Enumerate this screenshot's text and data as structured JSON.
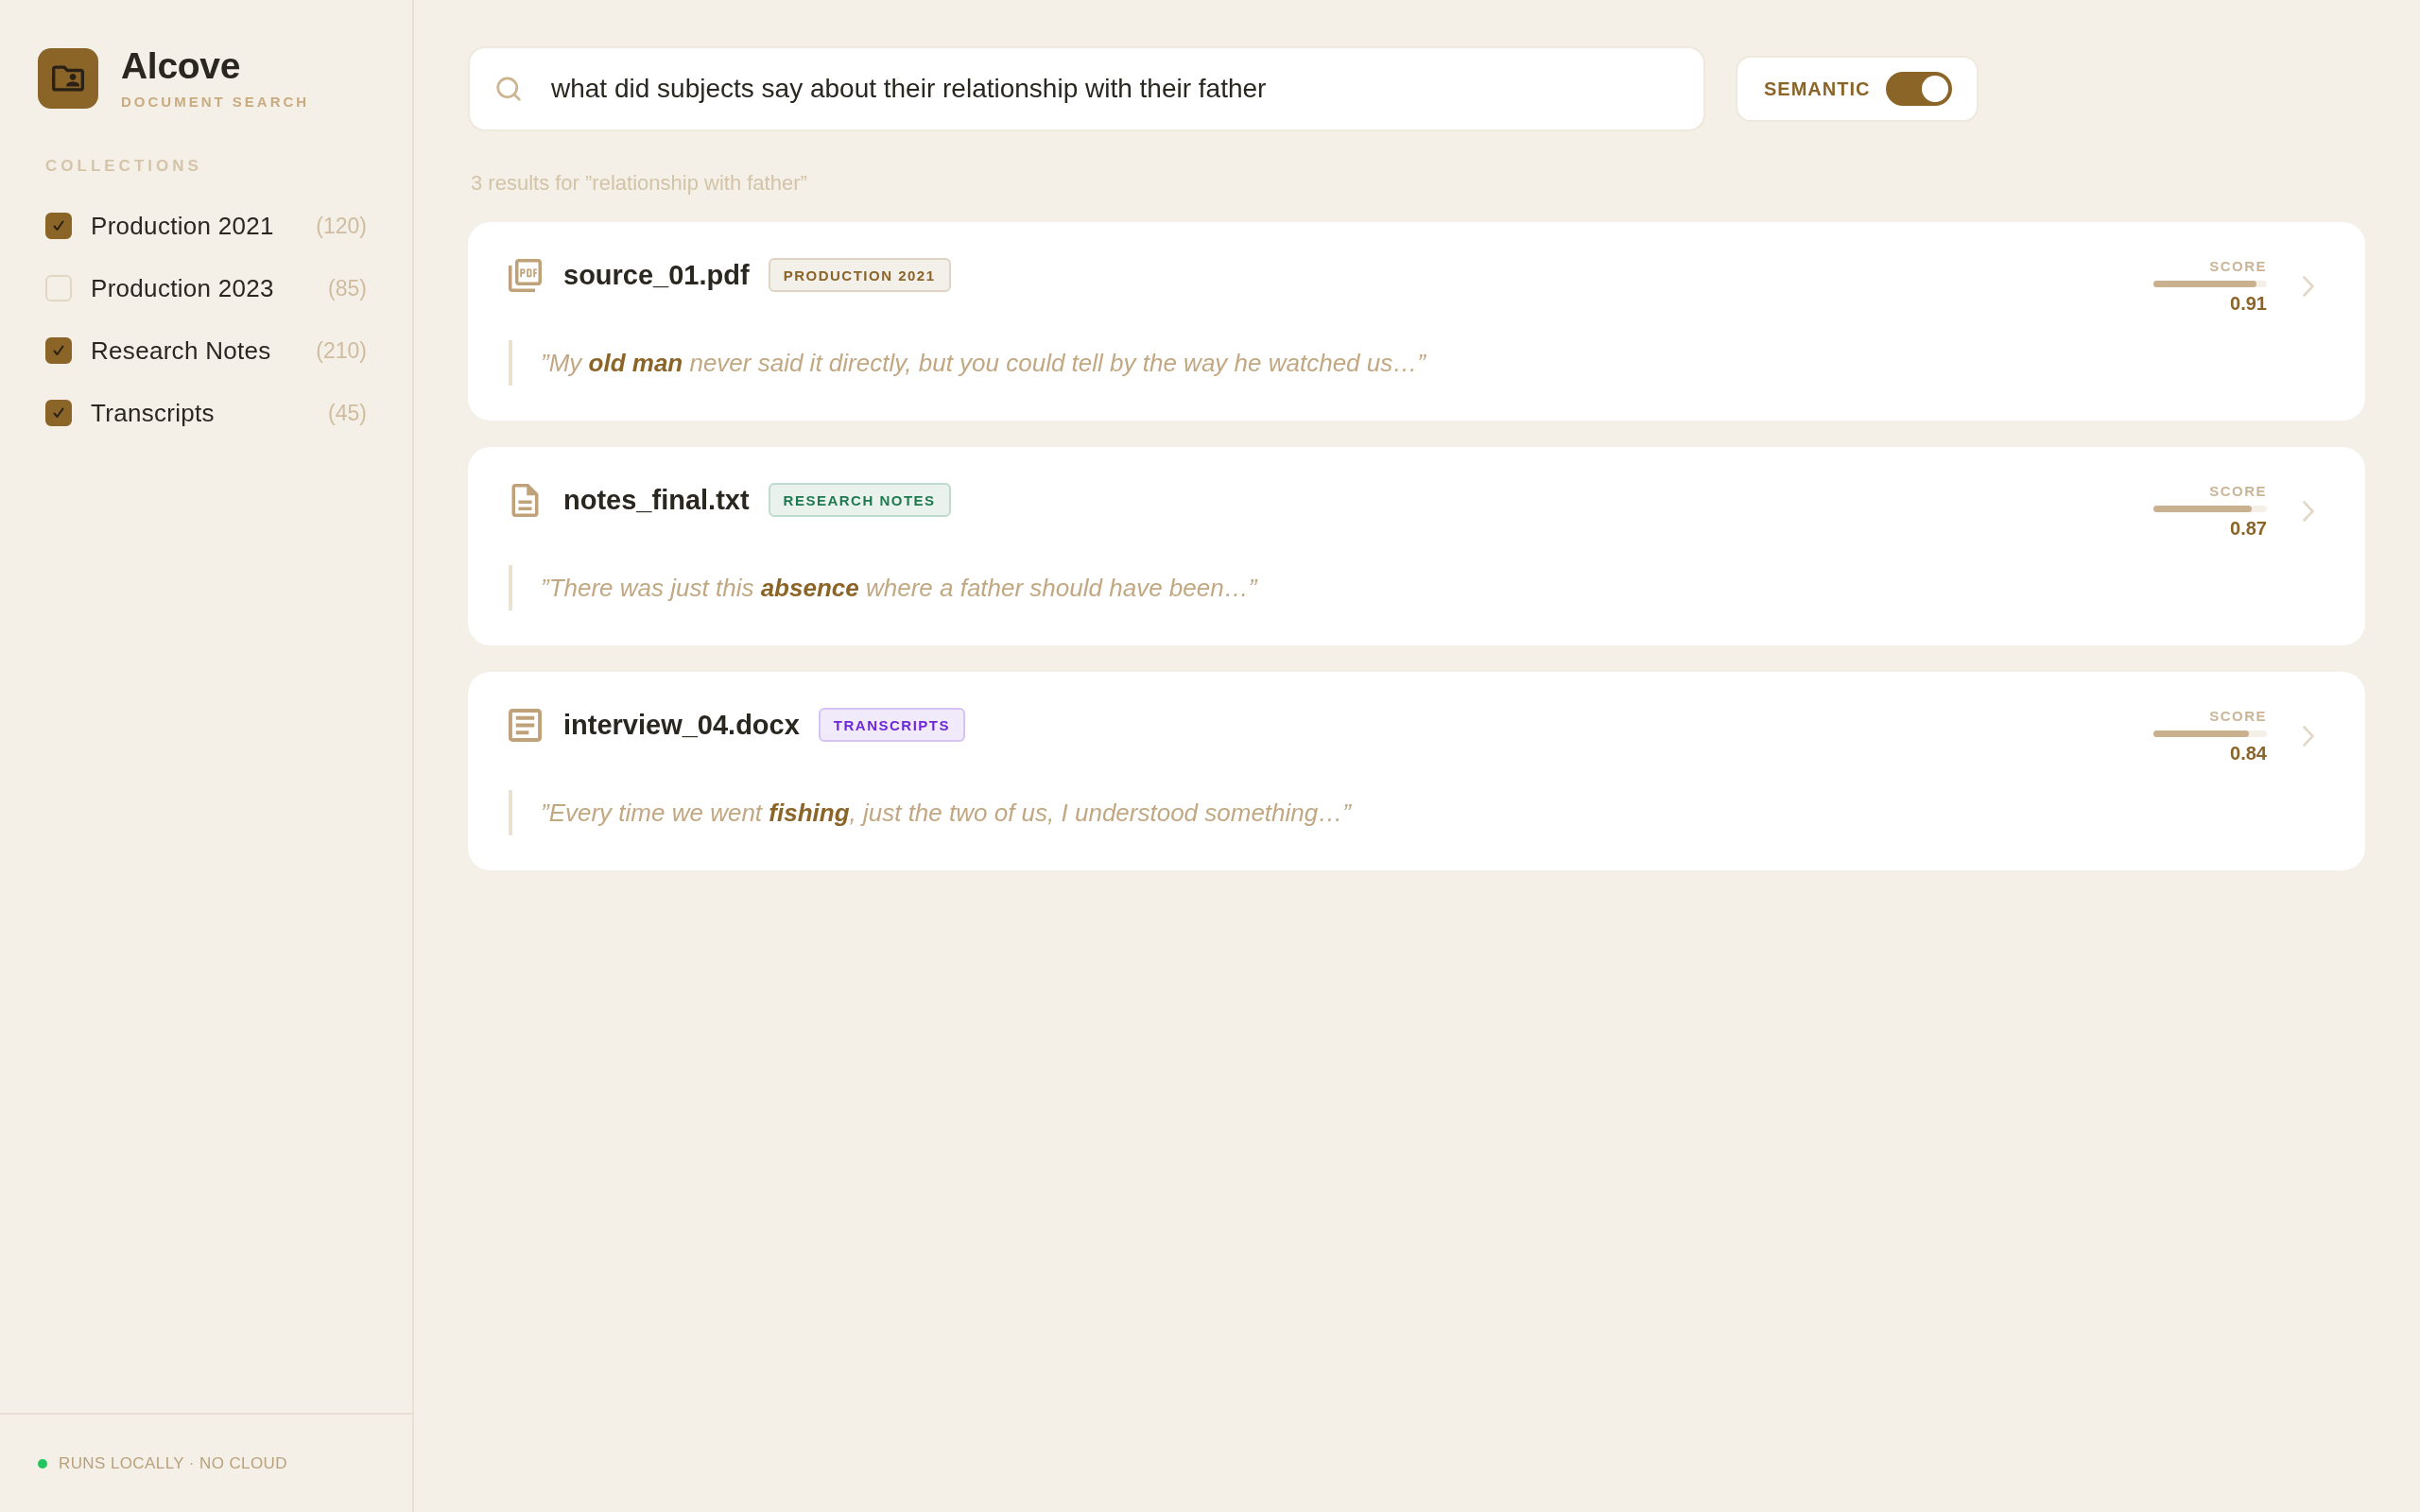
{
  "app": {
    "name": "Alcove",
    "subtitle": "DOCUMENT SEARCH"
  },
  "sidebar": {
    "heading": "COLLECTIONS",
    "collections": [
      {
        "label": "Production 2021",
        "count": "(120)",
        "checked": true
      },
      {
        "label": "Production 2023",
        "count": "(85)",
        "checked": false
      },
      {
        "label": "Research Notes",
        "count": "(210)",
        "checked": true
      },
      {
        "label": "Transcripts",
        "count": "(45)",
        "checked": true
      }
    ],
    "footer": "RUNS LOCALLY · NO CLOUD"
  },
  "search": {
    "value": "what did subjects say about their relationship with their father"
  },
  "semantic_toggle": {
    "label": "SEMANTIC",
    "on": true
  },
  "results_summary": "3 results for ”relationship with father”",
  "results": [
    {
      "kind": "pdf",
      "filename": "source_01.pdf",
      "collection": {
        "label": "PRODUCTION 2021",
        "color": "#8b6428"
      },
      "snippet": "”My **old man** never said it directly, but you could tell by the way he watched us…”",
      "score": {
        "label": "SCORE",
        "level": 0.91,
        "value": "0.91"
      }
    },
    {
      "kind": "text",
      "filename": "notes_final.txt",
      "collection": {
        "label": "RESEARCH NOTES",
        "color": "#1f7a4f"
      },
      "snippet": "”There was just this **absence** where a father should have been…”",
      "score": {
        "label": "SCORE",
        "level": 0.87,
        "value": "0.87"
      }
    },
    {
      "kind": "document",
      "filename": "interview_04.docx",
      "collection": {
        "label": "TRANSCRIPTS",
        "color": "#6d28d9"
      },
      "snippet": "”Every time we went **fishing**, just the two of us, I understood something…”",
      "score": {
        "label": "SCORE",
        "level": 0.84,
        "value": "0.84"
      }
    }
  ]
}
